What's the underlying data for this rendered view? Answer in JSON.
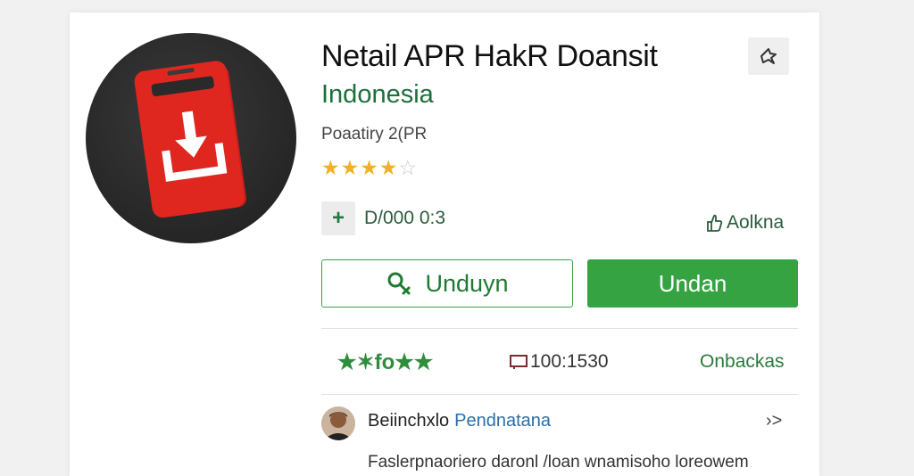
{
  "app": {
    "title": "Netail APR HakR Doansit",
    "subtitle": "Indonesia",
    "category": "Poaatiry 2(PR",
    "rating_stars": 4.5,
    "meta_text": "D/000 0:3",
    "meta_badge_icon": "plus-icon",
    "meta_right_label": "Aolkna",
    "meta_right_icon": "thumb-icon",
    "share_icon": "share-icon"
  },
  "actions": {
    "outline_label": "Unduyn",
    "outline_icon": "search-icon",
    "solid_label": "Undan"
  },
  "stats": {
    "left": "★✶fo★★",
    "mid_value": "100:1530",
    "mid_icon": "download-box-icon",
    "right": "Onbackas"
  },
  "review": {
    "name": "Beiinchxlo",
    "role": "Pendnatana",
    "text": "Faslerpnaoriero daronl /loan wnamisoho loreowem",
    "chevron": "›>"
  },
  "colors": {
    "accent_green": "#36a342",
    "subtitle_green": "#1b6f39",
    "icon_red": "#d9251d",
    "star_gold": "#f2b027"
  }
}
